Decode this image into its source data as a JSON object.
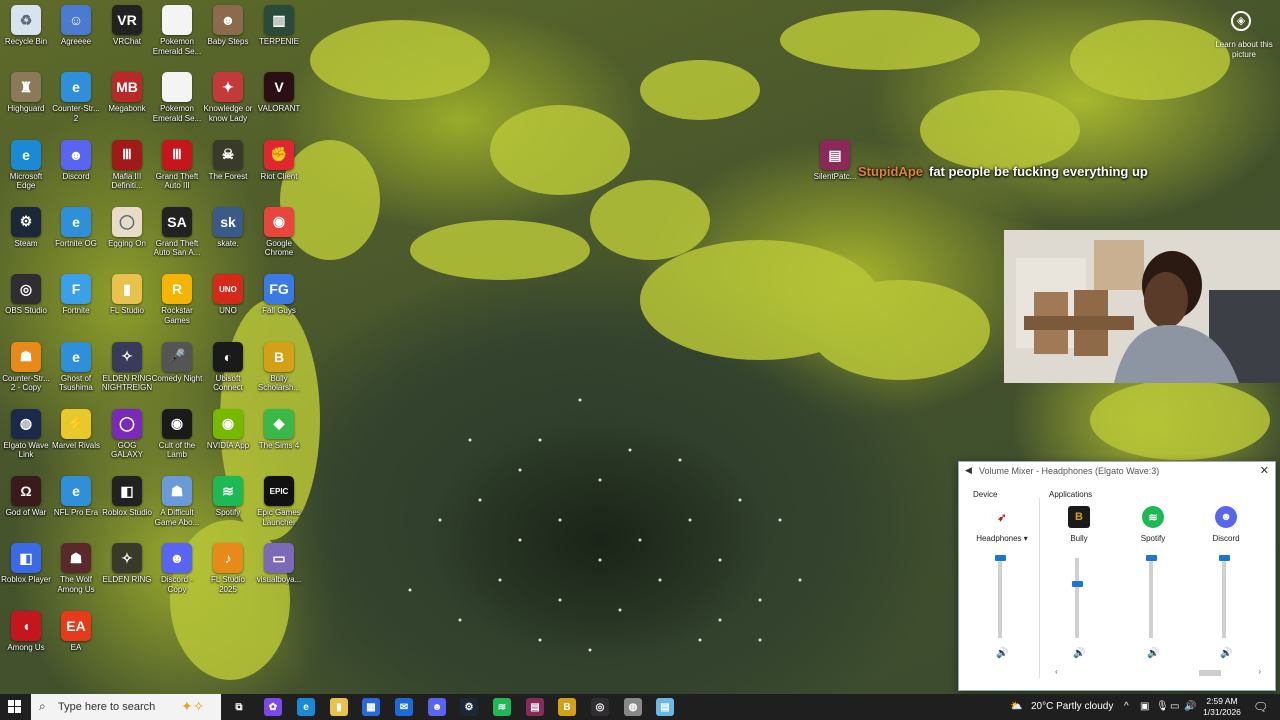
{
  "desktop": {
    "icons": [
      {
        "label": "Recycle Bin",
        "icon": "recycle-bin-icon",
        "color": "#d7e3ee",
        "glyph": "♻"
      },
      {
        "label": "Agreeee",
        "icon": "avatar-icon",
        "color": "#4a7bd0",
        "glyph": "☺"
      },
      {
        "label": "VRChat",
        "icon": "vrchat-icon",
        "color": "#222222",
        "glyph": "VR"
      },
      {
        "label": "Pokemon Emerald Se...",
        "icon": "file-icon",
        "color": "#f4f4f4",
        "glyph": ""
      },
      {
        "label": "Baby Steps",
        "icon": "baby-steps-icon",
        "color": "#8c6a4c",
        "glyph": "☻"
      },
      {
        "label": "TERPENIE",
        "icon": "terpenie-icon",
        "color": "#2a4a3a",
        "glyph": "▥"
      },
      {
        "label": "Highguard",
        "icon": "highguard-icon",
        "color": "#8a7a5a",
        "glyph": "♜"
      },
      {
        "label": "Counter-Str... 2",
        "icon": "internet-shortcut-icon",
        "color": "#2f8fd8",
        "glyph": "e"
      },
      {
        "label": "Megabonk",
        "icon": "megabonk-icon",
        "color": "#b8292a",
        "glyph": "MB"
      },
      {
        "label": "Pokemon Emerald Se...",
        "icon": "file-icon",
        "color": "#f4f4f4",
        "glyph": ""
      },
      {
        "label": "Knowledge or know Lady",
        "icon": "knowledge-icon",
        "color": "#c23a3a",
        "glyph": "✦"
      },
      {
        "label": "VALORANT",
        "icon": "valorant-icon",
        "color": "#2a0f14",
        "glyph": "V"
      },
      {
        "label": "Microsoft Edge",
        "icon": "edge-icon",
        "color": "#1a8ad4",
        "glyph": "e"
      },
      {
        "label": "Discord",
        "icon": "discord-icon",
        "color": "#5865f2",
        "glyph": "☻"
      },
      {
        "label": "Mafia III Definiti...",
        "icon": "mafia-icon",
        "color": "#a01a1a",
        "glyph": "Ⅲ"
      },
      {
        "label": "Grand Theft Auto III",
        "icon": "gta3-icon",
        "color": "#c4161c",
        "glyph": "Ⅲ"
      },
      {
        "label": "The Forest",
        "icon": "forest-icon",
        "color": "#3a3a2a",
        "glyph": "☠"
      },
      {
        "label": "Riot Client",
        "icon": "riot-icon",
        "color": "#e0262e",
        "glyph": "✊"
      },
      {
        "label": "Steam",
        "icon": "steam-icon",
        "color": "#1b2838",
        "glyph": "⚙"
      },
      {
        "label": "Fortnite OG",
        "icon": "internet-shortcut-icon",
        "color": "#2f8fd8",
        "glyph": "e"
      },
      {
        "label": "Egging On",
        "icon": "egg-icon",
        "color": "#e8dcc8",
        "glyph": "◯"
      },
      {
        "label": "Grand Theft Auto San A...",
        "icon": "gta-sa-icon",
        "color": "#222222",
        "glyph": "SA"
      },
      {
        "label": "skate.",
        "icon": "skate-icon",
        "color": "#3a5a8a",
        "glyph": "sk"
      },
      {
        "label": "Google Chrome",
        "icon": "chrome-icon",
        "color": "#e8453c",
        "glyph": "◉"
      },
      {
        "label": "OBS Studio",
        "icon": "obs-icon",
        "color": "#302e31",
        "glyph": "◎"
      },
      {
        "label": "Fortnite",
        "icon": "fortnite-icon",
        "color": "#3aa0e8",
        "glyph": "F"
      },
      {
        "label": "FL Studio",
        "icon": "folder-icon",
        "color": "#e8c24a",
        "glyph": "▮"
      },
      {
        "label": "Rockstar Games",
        "icon": "rockstar-icon",
        "color": "#f4b400",
        "glyph": "R"
      },
      {
        "label": "UNO",
        "icon": "uno-icon",
        "color": "#d42a1a",
        "glyph": "UNO"
      },
      {
        "label": "Fall Guys",
        "icon": "fall-guys-icon",
        "color": "#3a7ae8",
        "glyph": "FG"
      },
      {
        "label": "Counter-Str... 2 - Copy",
        "icon": "counter-strike-icon",
        "color": "#e88a1a",
        "glyph": "☗"
      },
      {
        "label": "Ghost of Tsushima",
        "icon": "internet-shortcut-icon",
        "color": "#2f8fd8",
        "glyph": "e"
      },
      {
        "label": "ELDEN RING NIGHTREIGN",
        "icon": "nightreign-icon",
        "color": "#3a3a5a",
        "glyph": "✧"
      },
      {
        "label": "Comedy Night",
        "icon": "microphone-icon",
        "color": "#555555",
        "glyph": "🎤"
      },
      {
        "label": "Ubisoft Connect",
        "icon": "ubisoft-icon",
        "color": "#1a1a1a",
        "glyph": "◐"
      },
      {
        "label": "Bully Scholarsh...",
        "icon": "bully-icon",
        "color": "#d4a017",
        "glyph": "B"
      },
      {
        "label": "Elgato Wave Link",
        "icon": "wave-link-icon",
        "color": "#1a2a4a",
        "glyph": "◍"
      },
      {
        "label": "Marvel Rivals",
        "icon": "marvel-rivals-icon",
        "color": "#e8c82a",
        "glyph": "⚡"
      },
      {
        "label": "GOG GALAXY",
        "icon": "gog-icon",
        "color": "#7a2ab8",
        "glyph": "◯"
      },
      {
        "label": "Cult of the Lamb",
        "icon": "cult-lamb-icon",
        "color": "#1a1a1a",
        "glyph": "◉"
      },
      {
        "label": "NVIDIA App",
        "icon": "nvidia-icon",
        "color": "#76b900",
        "glyph": "◉"
      },
      {
        "label": "The Sims 4",
        "icon": "sims-icon",
        "color": "#3ab84a",
        "glyph": "◆"
      },
      {
        "label": "God of War",
        "icon": "god-of-war-icon",
        "color": "#3a1a1a",
        "glyph": "Ω"
      },
      {
        "label": "NFL Pro Era",
        "icon": "internet-shortcut-icon",
        "color": "#2f8fd8",
        "glyph": "e"
      },
      {
        "label": "Roblox Studio",
        "icon": "roblox-studio-icon",
        "color": "#222222",
        "glyph": "◧"
      },
      {
        "label": "A Difficult Game Abo...",
        "icon": "difficult-game-icon",
        "color": "#6a9ad8",
        "glyph": "☗"
      },
      {
        "label": "Spotify",
        "icon": "spotify-icon",
        "color": "#1db954",
        "glyph": "≋"
      },
      {
        "label": "Epic Games Launcher",
        "icon": "epic-games-icon",
        "color": "#111111",
        "glyph": "EPIC"
      },
      {
        "label": "Roblox Player",
        "icon": "roblox-icon",
        "color": "#3a6ae8",
        "glyph": "◧"
      },
      {
        "label": "The Wolf Among Us",
        "icon": "wolf-among-us-icon",
        "color": "#5a2a2a",
        "glyph": "☗"
      },
      {
        "label": "ELDEN RING",
        "icon": "elden-ring-icon",
        "color": "#3a3a2a",
        "glyph": "✧"
      },
      {
        "label": "Discord - Copy",
        "icon": "discord-icon",
        "color": "#5865f2",
        "glyph": "☻"
      },
      {
        "label": "FL Studio 2025",
        "icon": "fl-studio-icon",
        "color": "#e88a1a",
        "glyph": "♪"
      },
      {
        "label": "visualboya...",
        "icon": "gameboy-icon",
        "color": "#7a6ab8",
        "glyph": "▭"
      },
      {
        "label": "Among Us",
        "icon": "among-us-icon",
        "color": "#c4161c",
        "glyph": "◖"
      },
      {
        "label": "EA",
        "icon": "ea-icon",
        "color": "#e8391a",
        "glyph": "EA"
      },
      {
        "label": "SilentPatc...",
        "icon": "winrar-icon",
        "color": "#8a2a5a",
        "glyph": "▤"
      }
    ],
    "learn_label": "Learn about this picture"
  },
  "stream_overlay": {
    "chat_user": "StupidApe",
    "chat_message": "fat people be fucking everything up"
  },
  "volume_mixer": {
    "title": "Volume Mixer - Headphones (Elgato Wave:3)",
    "device_header": "Device",
    "applications_header": "Applications",
    "device_name": "Headphones",
    "apps": [
      {
        "name": "Bully",
        "icon": "bully-icon",
        "color": "#d4a017",
        "glyph": "B",
        "level": 1.0
      },
      {
        "name": "Spotify",
        "icon": "spotify-icon",
        "color": "#1db954",
        "glyph": "≋",
        "level": 1.0
      },
      {
        "name": "Discord",
        "icon": "discord-icon",
        "color": "#5865f2",
        "glyph": "☻",
        "level": 1.0
      }
    ],
    "device_level": 1.0,
    "bully_level": 0.68
  },
  "taskbar": {
    "search_placeholder": "Type here to search",
    "pinned": [
      {
        "icon": "task-view-icon",
        "color": "#1f1f1f",
        "glyph": "⧉"
      },
      {
        "icon": "copilot-icon",
        "color": "#7a4ae8",
        "glyph": "✿"
      },
      {
        "icon": "edge-icon",
        "color": "#1a8ad4",
        "glyph": "e"
      },
      {
        "icon": "file-explorer-icon",
        "color": "#e8c24a",
        "glyph": "▮"
      },
      {
        "icon": "store-icon",
        "color": "#2a6ad8",
        "glyph": "▦"
      },
      {
        "icon": "outlook-icon",
        "color": "#1a6ad8",
        "glyph": "✉"
      },
      {
        "icon": "discord-icon",
        "color": "#5865f2",
        "glyph": "☻"
      },
      {
        "icon": "steam-icon",
        "color": "#1b2838",
        "glyph": "⚙"
      },
      {
        "icon": "spotify-icon",
        "color": "#1db954",
        "glyph": "≋"
      },
      {
        "icon": "winrar-icon",
        "color": "#8a2a5a",
        "glyph": "▤"
      },
      {
        "icon": "bully-icon",
        "color": "#d4a017",
        "glyph": "B"
      },
      {
        "icon": "obs-icon",
        "color": "#302e31",
        "glyph": "◎"
      },
      {
        "icon": "app-icon",
        "color": "#888888",
        "glyph": "◍"
      },
      {
        "icon": "notepad-icon",
        "color": "#6ab8e8",
        "glyph": "▤"
      }
    ],
    "weather": "20°C  Partly cloudy",
    "time": "2:59 AM",
    "date": "1/31/2026"
  }
}
